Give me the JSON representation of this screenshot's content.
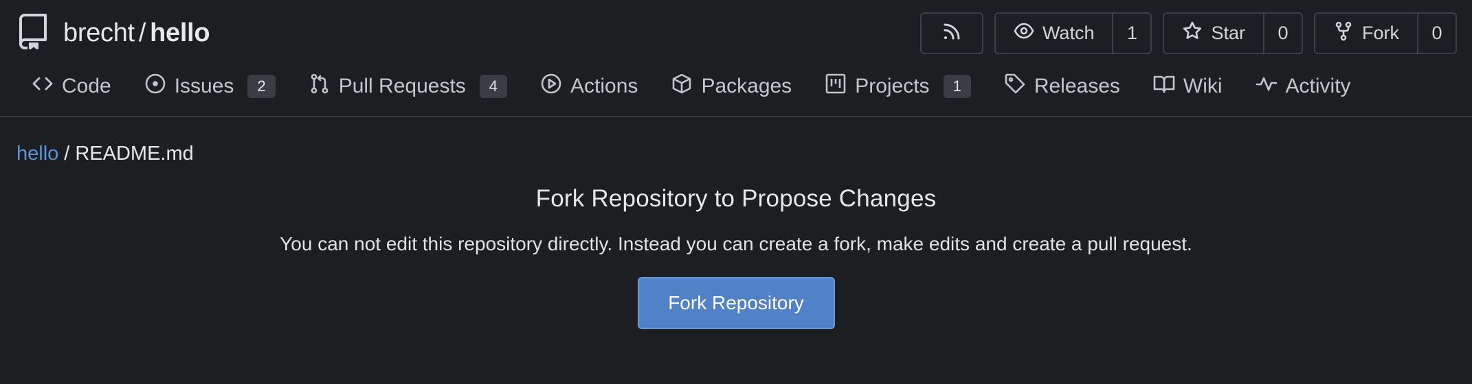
{
  "repo": {
    "owner": "brecht",
    "separator": "/",
    "name": "hello"
  },
  "header_actions": {
    "watch_label": "Watch",
    "watch_count": "1",
    "star_label": "Star",
    "star_count": "0",
    "fork_label": "Fork",
    "fork_count": "0"
  },
  "tabs": [
    {
      "label": "Code",
      "icon": "code-icon"
    },
    {
      "label": "Issues",
      "icon": "issue-icon",
      "badge": "2"
    },
    {
      "label": "Pull Requests",
      "icon": "pull-request-icon",
      "badge": "4"
    },
    {
      "label": "Actions",
      "icon": "play-icon"
    },
    {
      "label": "Packages",
      "icon": "package-icon"
    },
    {
      "label": "Projects",
      "icon": "project-icon",
      "badge": "1"
    },
    {
      "label": "Releases",
      "icon": "tag-icon"
    },
    {
      "label": "Wiki",
      "icon": "book-icon"
    },
    {
      "label": "Activity",
      "icon": "pulse-icon"
    }
  ],
  "breadcrumb": {
    "repo_link": "hello",
    "separator": "/",
    "file": "README.md"
  },
  "main": {
    "heading": "Fork Repository to Propose Changes",
    "message": "You can not edit this repository directly. Instead you can create a fork, make edits and create a pull request.",
    "button_label": "Fork Repository"
  },
  "colors": {
    "background": "#1c1e21",
    "link": "#5d92d8",
    "primary_button": "#5181c6"
  }
}
